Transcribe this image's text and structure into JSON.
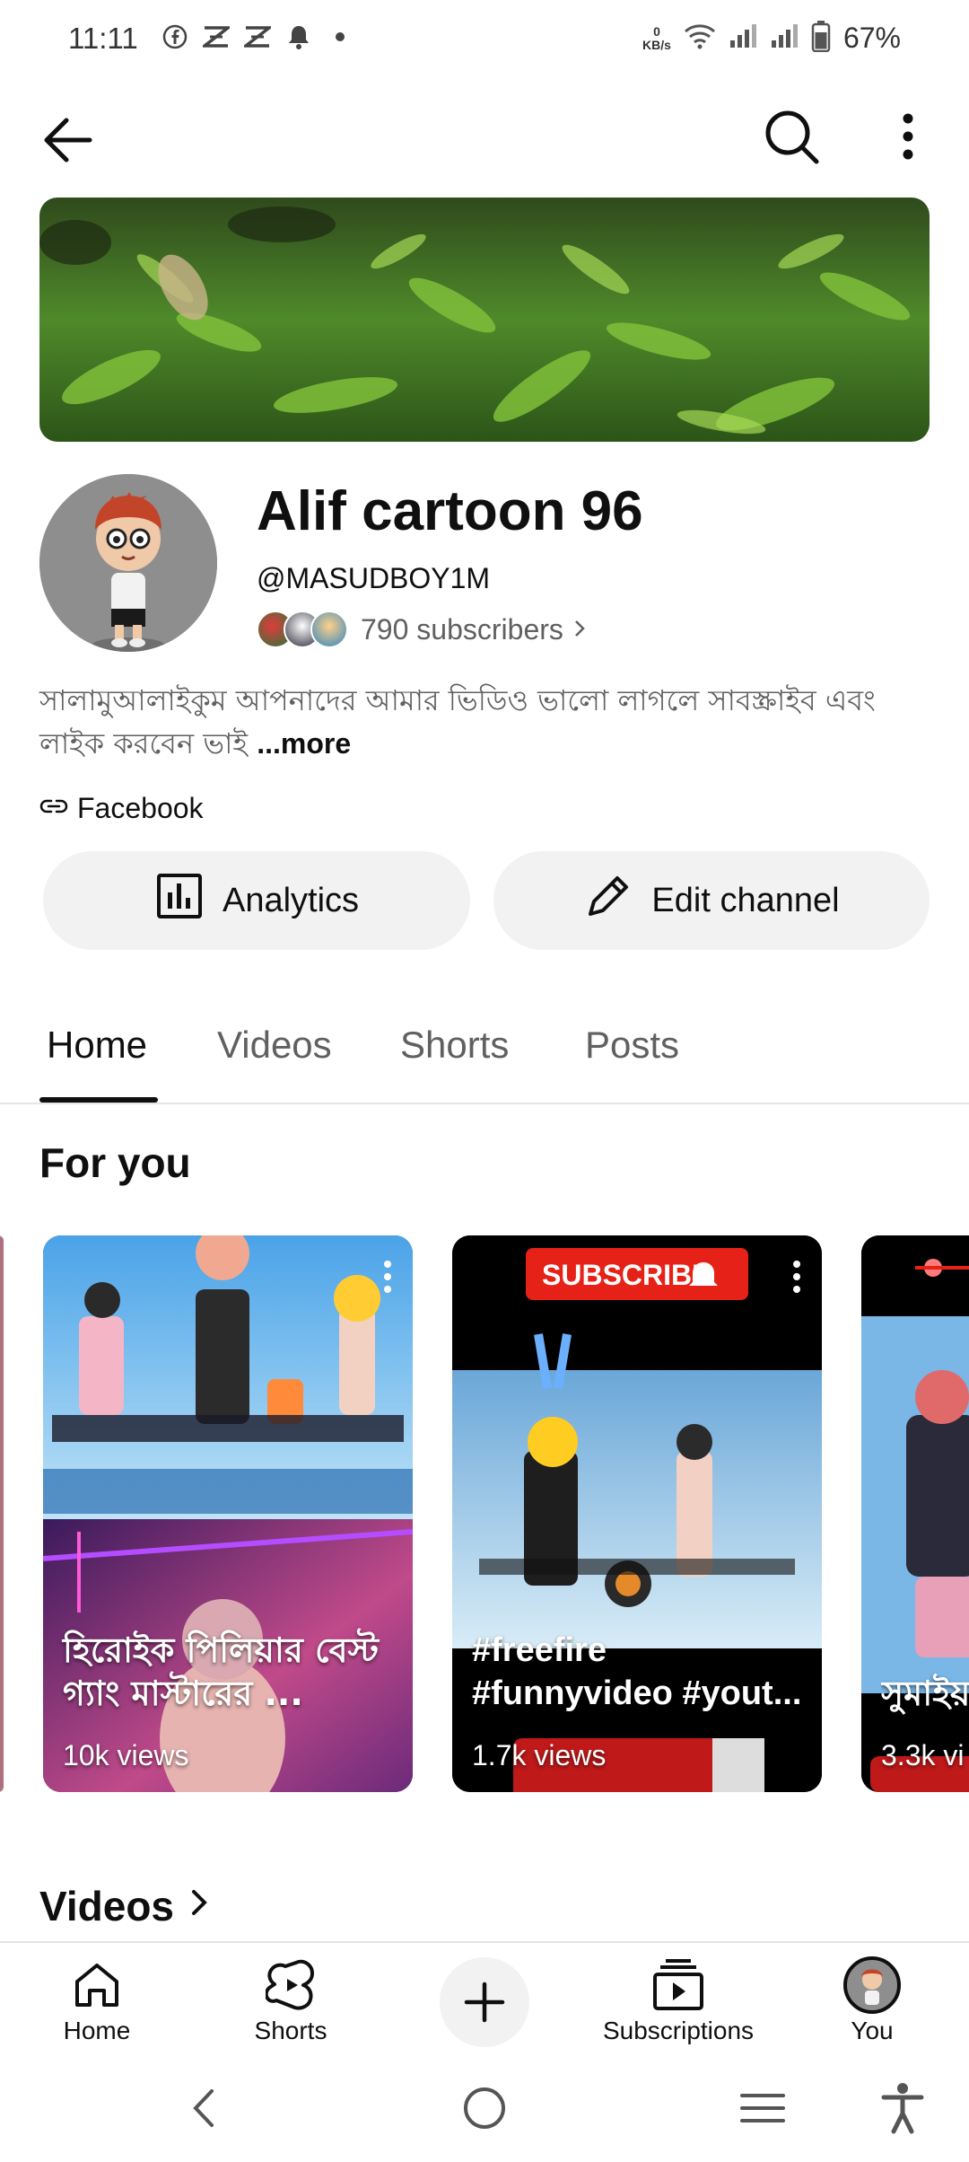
{
  "status_bar": {
    "time": "11:11",
    "kbs_top": "0",
    "kbs_bottom": "KB/s",
    "battery": "67%"
  },
  "channel": {
    "name": "Alif cartoon 96",
    "handle": "@MASUDBOY1M",
    "subscribers": "790 subscribers",
    "description": "সালামুআলাইকুম আপনাদের আমার ভিডিও ভালো লাগলে সাবস্ক্রাইব এবং লাইক করবেন ভাই ",
    "more_label": "...more",
    "link_label": "Facebook"
  },
  "actions": {
    "analytics_label": "Analytics",
    "edit_label": "Edit channel"
  },
  "tabs": [
    {
      "label": "Home",
      "active": true
    },
    {
      "label": "Videos",
      "active": false
    },
    {
      "label": "Shorts",
      "active": false
    },
    {
      "label": "Posts",
      "active": false
    }
  ],
  "sections": {
    "for_you": "For you",
    "videos": "Videos"
  },
  "cards": [
    {
      "title": "হিরোইক পিলিয়ার বেস্ট গ্যাং মাস্টারের ...",
      "views": "10k views"
    },
    {
      "title": "#freefire #funnyvideo #yout...",
      "views": "1.7k views",
      "banner": "SUBSCRIBE"
    },
    {
      "title": "সুমাইয়",
      "views": "3.3k vi"
    }
  ],
  "bottom_nav": [
    {
      "label": "Home"
    },
    {
      "label": "Shorts"
    },
    {
      "label": "Subscriptions"
    },
    {
      "label": "You"
    }
  ],
  "colors": {
    "text_primary": "#0f0f0f",
    "text_secondary": "#606060",
    "pill_bg": "#f2f2f2",
    "divider": "#e5e5e5",
    "subscribe_red": "#e62117"
  }
}
